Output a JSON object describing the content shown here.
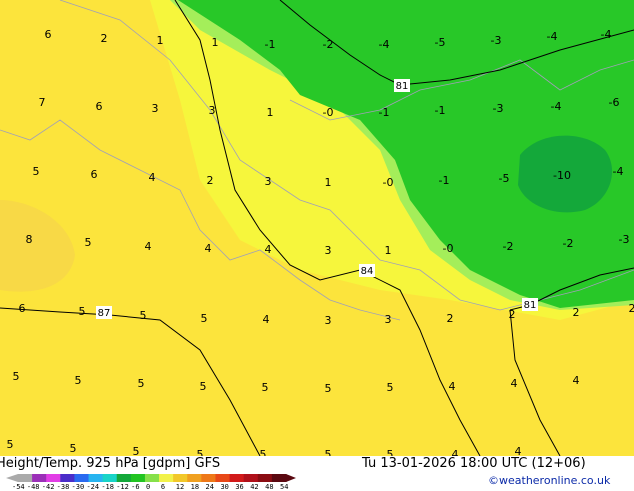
{
  "footer": {
    "title": "Height/Temp. 925 hPa [gdpm] GFS",
    "valid": "Tu 13-01-2026 18:00 UTC (12+06)",
    "credit": "©weatheronline.co.uk",
    "colorbar_ticks": [
      "-54",
      "-48",
      "-42",
      "-38",
      "-30",
      "-24",
      "-18",
      "-12",
      "-6",
      "0",
      "6",
      "12",
      "18",
      "24",
      "30",
      "36",
      "42",
      "48",
      "54"
    ],
    "colorbar_colors": [
      "#aaaaaa",
      "#9b2fb8",
      "#e23de6",
      "#4a2dc9",
      "#2a6af0",
      "#27b4f0",
      "#19d4c8",
      "#14a83a",
      "#22c422",
      "#86e04a",
      "#f2f24a",
      "#f2c82a",
      "#f0a020",
      "#ee7818",
      "#e84818",
      "#d21a1a",
      "#b0101a",
      "#8a0c12",
      "#5a0810"
    ]
  },
  "contours": [
    {
      "label": "81"
    },
    {
      "label": "84"
    },
    {
      "label": "87"
    },
    {
      "label": "81"
    }
  ],
  "temps": [
    "6",
    "2",
    "1",
    "1",
    "-1",
    "-2",
    "-4",
    "-5",
    "-3",
    "-4",
    "-4",
    "7",
    "6",
    "3",
    "3",
    "1",
    "-0",
    "-1",
    "-1",
    "-3",
    "-4",
    "-6",
    "5",
    "6",
    "4",
    "2",
    "3",
    "1",
    "-0",
    "-1",
    "-5",
    "-10",
    "-4",
    "8",
    "5",
    "4",
    "4",
    "4",
    "3",
    "1",
    "-0",
    "-2",
    "-2",
    "-3",
    "6",
    "5",
    "5",
    "5",
    "4",
    "3",
    "3",
    "2",
    "2",
    "2",
    "2",
    "5",
    "5",
    "5",
    "5",
    "5",
    "5",
    "5",
    "4",
    "4",
    "4",
    "5",
    "5",
    "5",
    "5",
    "5",
    "5",
    "5",
    "4",
    "4"
  ]
}
